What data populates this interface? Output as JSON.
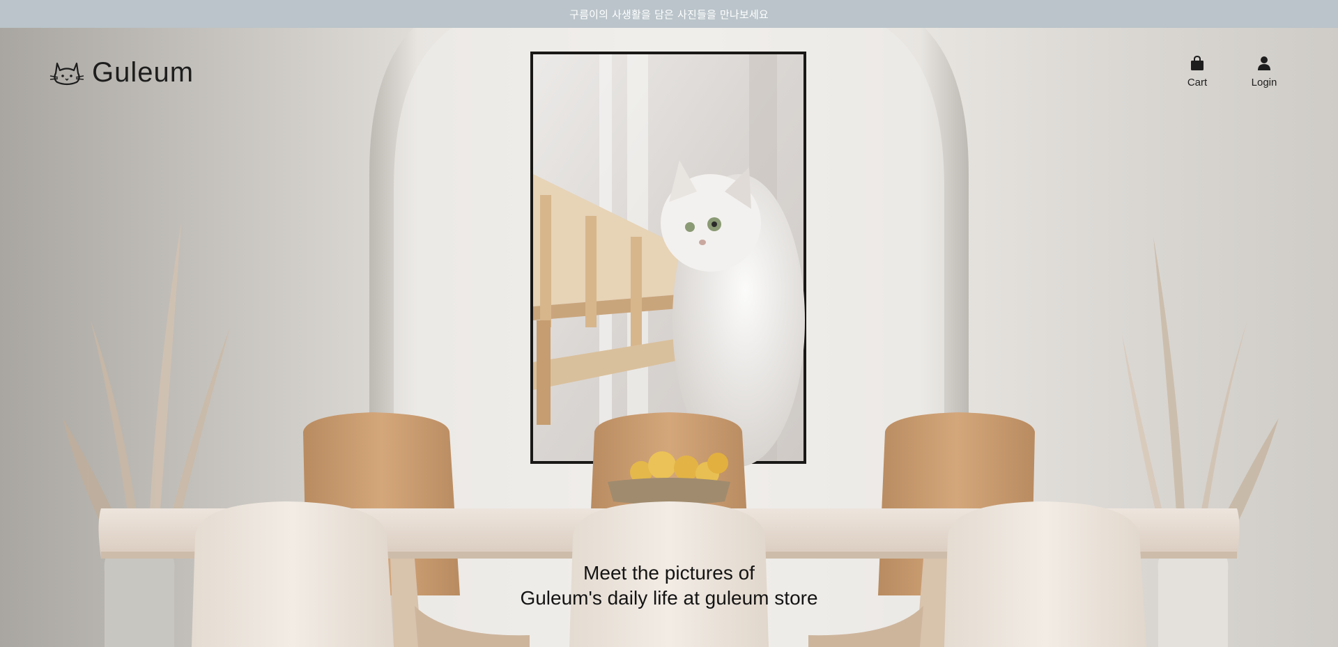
{
  "announcement": "구름이의 사생활을 담은 사진들을 만나보세요",
  "brand": {
    "name": "Guleum"
  },
  "nav": {
    "cart_label": "Cart",
    "login_label": "Login"
  },
  "hero": {
    "tagline_line1": "Meet the pictures of",
    "tagline_line2": "Guleum's daily life at guleum store"
  },
  "colors": {
    "announcement_bg": "#bac4ca",
    "announcement_text": "#ffffff",
    "text_dark": "#1d1d1d"
  },
  "icons": {
    "logo": "cat-icon",
    "cart": "shopping-bag-icon",
    "login": "user-icon"
  }
}
